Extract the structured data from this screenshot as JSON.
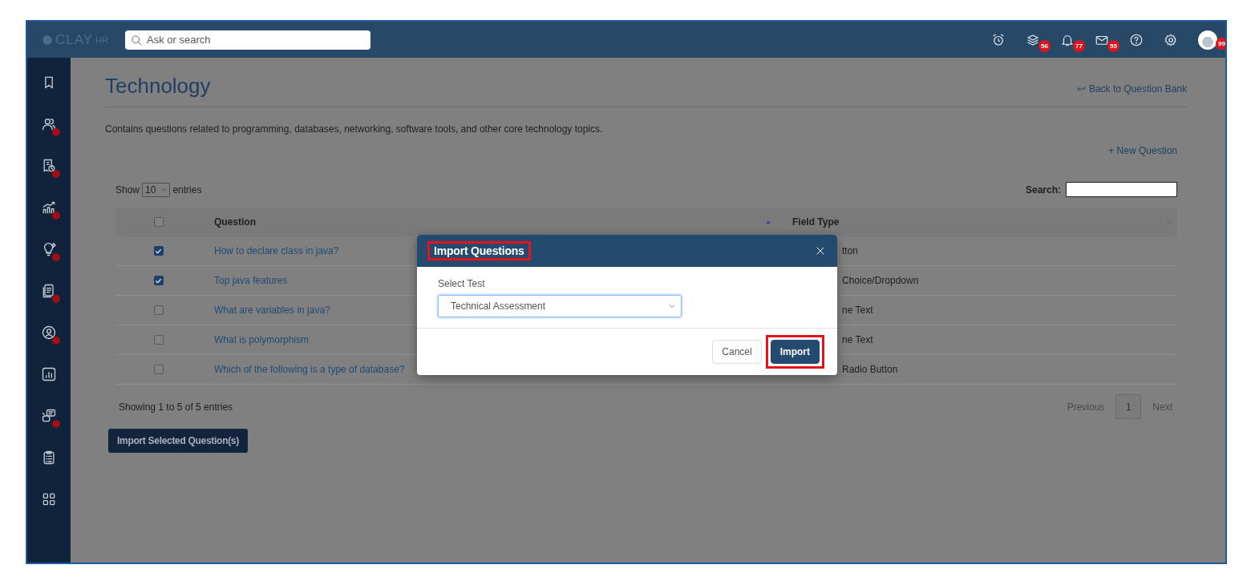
{
  "topbar": {
    "logo": {
      "text": "CLAY",
      "suffix": "HR"
    },
    "search": {
      "placeholder": "Ask or search"
    },
    "icons": [
      {
        "kind": "alarm"
      },
      {
        "kind": "layers",
        "badge": "56"
      },
      {
        "kind": "bell",
        "badge": "77"
      },
      {
        "kind": "mail",
        "badge": "55"
      },
      {
        "kind": "help"
      },
      {
        "kind": "settings"
      },
      {
        "kind": "avatar",
        "badge": "99"
      }
    ]
  },
  "sidebar": {
    "items": [
      {
        "kind": "bookmark",
        "dot": false
      },
      {
        "kind": "people",
        "dot": true
      },
      {
        "kind": "money",
        "dot": true
      },
      {
        "kind": "growth",
        "dot": true
      },
      {
        "kind": "bulb",
        "dot": true
      },
      {
        "kind": "document",
        "dot": true
      },
      {
        "kind": "person",
        "dot": true
      },
      {
        "kind": "chart",
        "dot": false
      },
      {
        "kind": "robot",
        "dot": true
      },
      {
        "kind": "clipboard",
        "dot": false
      },
      {
        "kind": "grid",
        "dot": false
      }
    ]
  },
  "page": {
    "title": "Technology",
    "back_link": "Back to Question Bank",
    "description": "Contains questions related to programming, databases, networking, software tools, and other core technology topics.",
    "new_question": "+ New Question",
    "show_label": "Show",
    "entries_value": "10",
    "entries_label": "entries",
    "search_label": "Search:"
  },
  "table": {
    "header_checked": false,
    "columns": [
      {
        "label": "Question",
        "sorted": true
      },
      {
        "label": "Field Type",
        "sorted": false
      }
    ],
    "rows": [
      {
        "checked": true,
        "question": "How to declare class in java?",
        "field_type": "tton"
      },
      {
        "checked": true,
        "question": "Top java features",
        "field_type": "Choice/Dropdown"
      },
      {
        "checked": false,
        "question": "What are variables in java?",
        "field_type": "ne Text"
      },
      {
        "checked": false,
        "question": "What is polymorphism",
        "field_type": "ne Text"
      },
      {
        "checked": false,
        "question": "Which of the following is a type of database?",
        "field_type": "Radio Button"
      }
    ]
  },
  "footer": {
    "info": "Showing 1 to 5 of 5 entries",
    "pages": [
      {
        "label": "Previous",
        "selected": false
      },
      {
        "label": "1",
        "selected": true
      },
      {
        "label": "Next",
        "selected": false
      }
    ],
    "import_button": "Import Selected Question(s)"
  },
  "modal": {
    "title": "Import Questions",
    "title_highlighted": true,
    "field_label": "Select Test",
    "select_value": "Technical Assessment",
    "buttons": [
      {
        "label": "Cancel",
        "kind": "secondary",
        "highlighted": false
      },
      {
        "label": "Import",
        "kind": "primary",
        "highlighted": true
      }
    ]
  }
}
